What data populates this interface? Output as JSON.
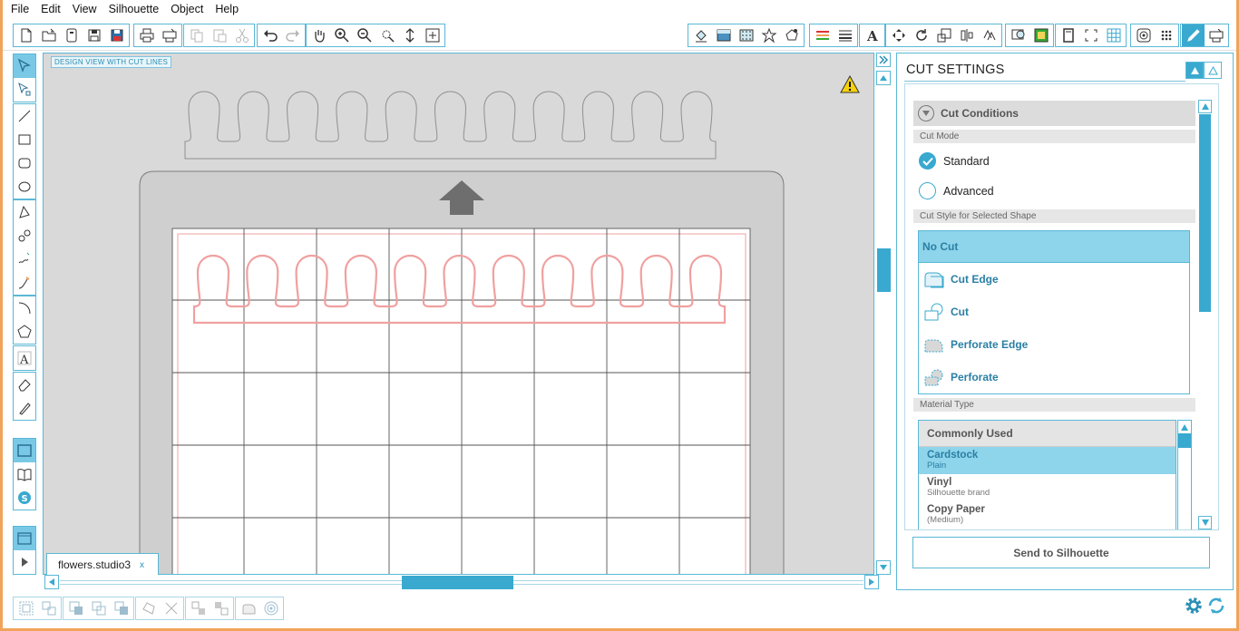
{
  "menu": [
    "File",
    "Edit",
    "View",
    "Silhouette",
    "Object",
    "Help"
  ],
  "canvas": {
    "view_label": "DESIGN VIEW WITH CUT LINES",
    "document_tab": "flowers.studio3",
    "tab_close": "x"
  },
  "panel": {
    "title": "CUT SETTINGS",
    "cut_conditions": "Cut Conditions",
    "cut_mode_label": "Cut Mode",
    "mode_standard": "Standard",
    "mode_advanced": "Advanced",
    "cut_style_label": "Cut Style for Selected Shape",
    "styles": [
      "No Cut",
      "Cut Edge",
      "Cut",
      "Perforate Edge",
      "Perforate"
    ],
    "material_label": "Material Type",
    "material_header": "Commonly Used",
    "materials": [
      {
        "name": "Cardstock",
        "sub": "Plain"
      },
      {
        "name": "Vinyl",
        "sub": "Silhouette brand"
      },
      {
        "name": "Copy Paper",
        "sub": "(Medium)"
      }
    ],
    "send_button": "Send to Silhouette"
  },
  "colors": {
    "accent": "#39a9cf",
    "highlight": "#8ed4ea",
    "cut_line": "#f0a0a0",
    "window_border": "#f1a35a"
  }
}
